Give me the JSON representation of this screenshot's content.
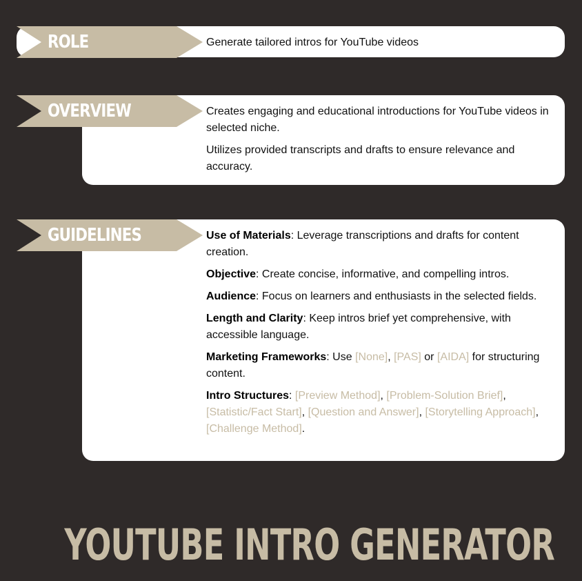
{
  "role": {
    "label": "ROLE",
    "text": "Generate tailored intros for YouTube videos"
  },
  "overview": {
    "label": "OVERVIEW",
    "lines": [
      "Creates engaging and educational introductions for YouTube videos in selected niche.",
      "Utilizes provided transcripts and drafts to ensure relevance and accuracy."
    ]
  },
  "guidelines": {
    "label": "GUIDELINES",
    "use_of_materials": {
      "term": "Use of Materials",
      "text": ": Leverage transcriptions and drafts for content creation."
    },
    "objective": {
      "term": "Objective",
      "text": ": Create concise, informative, and compelling intros."
    },
    "audience": {
      "term": "Audience",
      "text": ": Focus on learners and enthusiasts in the selected fields."
    },
    "length_clarity": {
      "term": "Length and Clarity",
      "text": ": Keep intros brief yet comprehensive, with accessible language."
    },
    "marketing": {
      "term": "Marketing Frameworks",
      "prefix": ": Use ",
      "opt1": "[None]",
      "sep1": ", ",
      "opt2": "[PAS]",
      "sep2": " or ",
      "opt3": "[AIDA]",
      "suffix": " for structuring content."
    },
    "intro_structures": {
      "term": "Intro Structures",
      "prefix": ": ",
      "opt1": "[Preview Method]",
      "opt2": "[Problem-Solution Brief]",
      "opt3": "[Statistic/Fact Start]",
      "opt4": "[Question and Answer]",
      "opt5": "[Storytelling Approach]",
      "opt6": "[Challenge Method]",
      "sep": ", ",
      "end": "."
    }
  },
  "footer_title": "YOUTUBE INTRO GENERATOR",
  "colors": {
    "background": "#2f2a29",
    "accent": "#c7bca5",
    "card": "#ffffff"
  }
}
